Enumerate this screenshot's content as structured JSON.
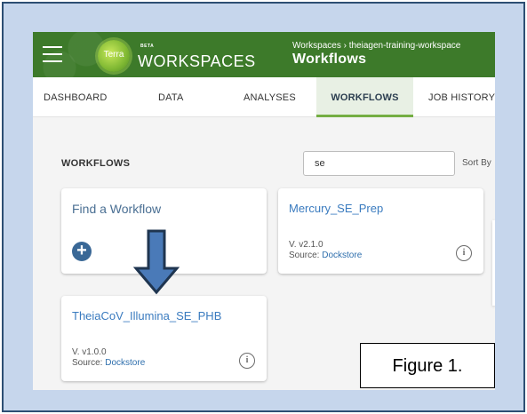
{
  "header": {
    "logo_text": "Terra",
    "badge": "BETA",
    "app_title": "WORKSPACES",
    "breadcrumb": "Workspaces › theiagen-training-workspace",
    "page_title": "Workflows"
  },
  "tabs": [
    {
      "label": "DASHBOARD",
      "active": false
    },
    {
      "label": "DATA",
      "active": false
    },
    {
      "label": "ANALYSES",
      "active": false
    },
    {
      "label": "WORKFLOWS",
      "active": true
    },
    {
      "label": "JOB HISTORY",
      "active": false
    }
  ],
  "main": {
    "section_label": "WORKFLOWS",
    "search": {
      "value": "se",
      "placeholder": ""
    },
    "sort_label": "Sort By",
    "find_card": {
      "title": "Find a Workflow",
      "icon": "plus-circle-icon"
    },
    "workflows": [
      {
        "name": "Mercury_SE_Prep",
        "version": "V. v2.1.0",
        "source_label": "Source: ",
        "source": "Dockstore"
      },
      {
        "name": "TheiaCoV_Illumina_SE_PHB",
        "version": "V. v1.0.0",
        "source_label": "Source: ",
        "source": "Dockstore"
      }
    ]
  },
  "annotation": {
    "figure_label": "Figure 1.",
    "arrow_icon": "down-arrow-icon"
  },
  "colors": {
    "header_bg": "#3d7a2a",
    "accent": "#74ae43",
    "link": "#3a7bbf",
    "frame_bg": "#c6d6ec",
    "frame_border": "#2d4f73",
    "arrow_fill": "#4a7ab8",
    "arrow_stroke": "#1f3550"
  }
}
